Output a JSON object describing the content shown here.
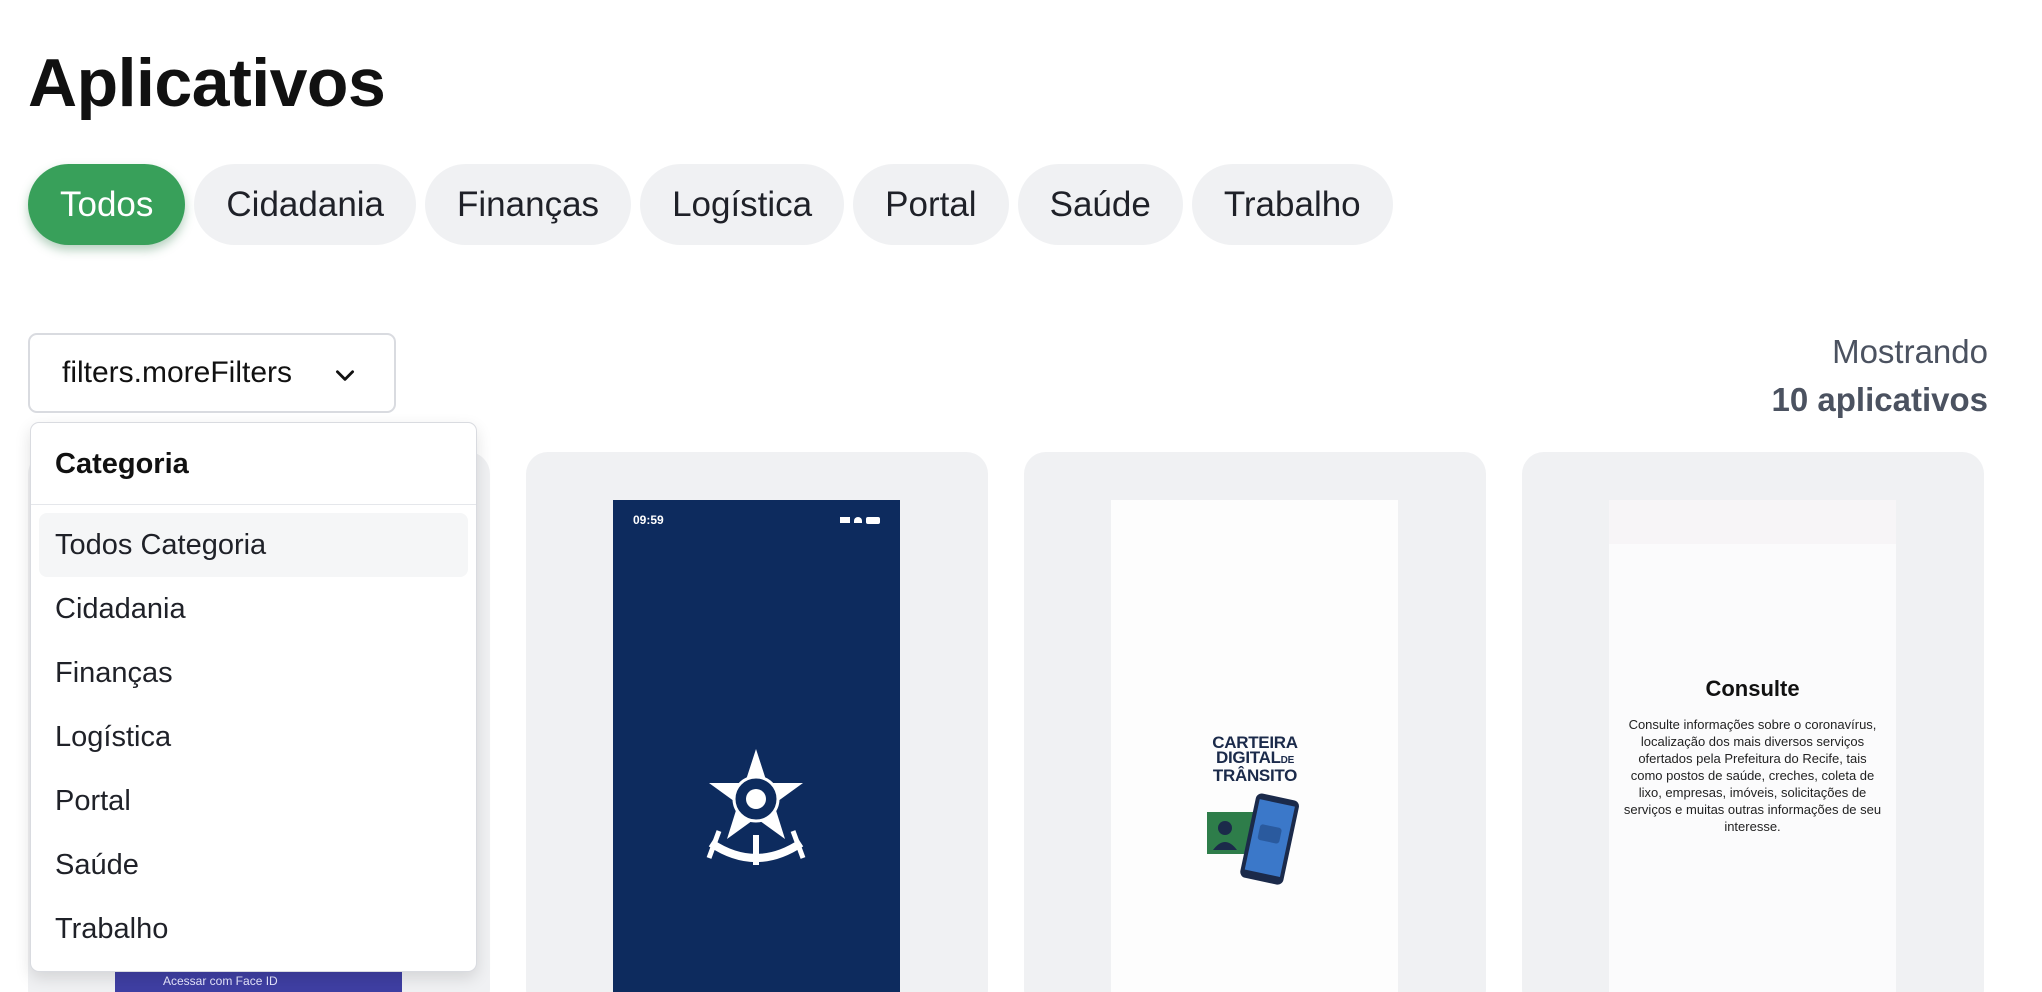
{
  "page_title": "Aplicativos",
  "chips": [
    {
      "label": "Todos",
      "active": true
    },
    {
      "label": "Cidadania",
      "active": false
    },
    {
      "label": "Finanças",
      "active": false
    },
    {
      "label": "Logística",
      "active": false
    },
    {
      "label": "Portal",
      "active": false
    },
    {
      "label": "Saúde",
      "active": false
    },
    {
      "label": "Trabalho",
      "active": false
    }
  ],
  "filter_button": {
    "label": "filters.moreFilters",
    "icon": "chevron-down-icon"
  },
  "results": {
    "line1": "Mostrando",
    "line2": "10 aplicativos"
  },
  "dropdown": {
    "header": "Categoria",
    "items": [
      "Todos Categoria",
      "Cidadania",
      "Finanças",
      "Logística",
      "Portal",
      "Saúde",
      "Trabalho"
    ],
    "highlighted_index": 0
  },
  "cards": [
    {
      "bottom_strip_text": "Acessar com Face ID"
    },
    {
      "status_time": "09:59",
      "icon": "brazil-coat-of-arms-icon"
    },
    {
      "logo_line1": "CARTEIRA",
      "logo_line2": "DIGITAL",
      "logo_de": "DE",
      "logo_line3": "TRÂNSITO",
      "icon": "phone-car-illustration-icon"
    },
    {
      "title": "Consulte",
      "body": "Consulte informações sobre o coronavírus, localização dos mais diversos serviços ofertados pela Prefeitura do Recife, tais como postos de saúde, creches, coleta de lixo, empresas, imóveis, solicitações de serviços e muitas outras informações de seu interesse."
    }
  ],
  "colors": {
    "accent": "#38a05a",
    "chip_bg": "#f0f1f3",
    "gov_blue": "#0d2b5e"
  }
}
